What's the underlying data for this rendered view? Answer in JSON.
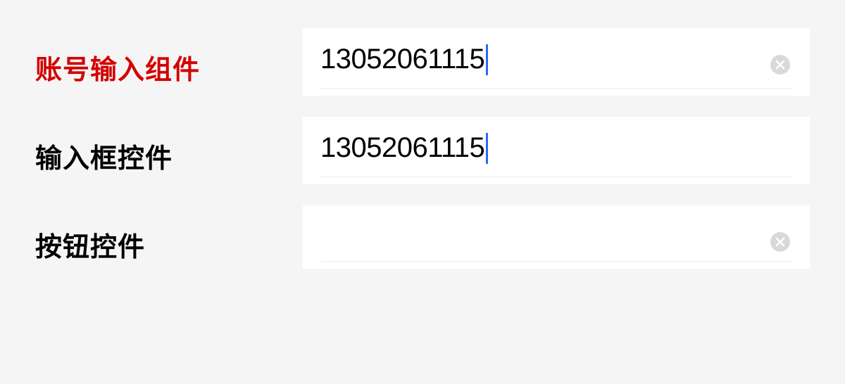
{
  "rows": [
    {
      "label": "账号输入组件",
      "value": "13052061115",
      "active": true,
      "showCaret": true,
      "showClear": true
    },
    {
      "label": "输入框控件",
      "value": "13052061115",
      "active": false,
      "showCaret": true,
      "showClear": false
    },
    {
      "label": "按钮控件",
      "value": "",
      "active": false,
      "showCaret": false,
      "showClear": true
    }
  ]
}
